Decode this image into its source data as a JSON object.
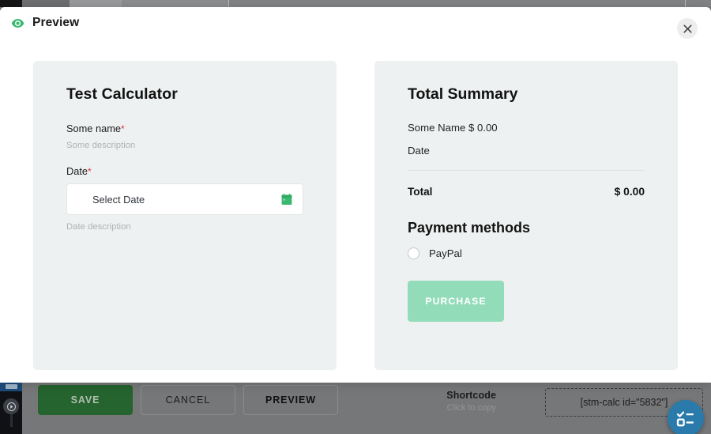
{
  "modal": {
    "title": "Preview",
    "eye_icon": "eye-icon",
    "close_icon": "close-icon"
  },
  "calculator": {
    "title": "Test Calculator",
    "fields": [
      {
        "label": "Some name",
        "required_mark": "*",
        "description": "Some description"
      },
      {
        "label": "Date",
        "required_mark": "*",
        "placeholder": "Select Date",
        "description": "Date description",
        "icon": "calendar-icon"
      }
    ]
  },
  "summary": {
    "title": "Total Summary",
    "lines": [
      "Some Name $ 0.00",
      "Date"
    ],
    "total_label": "Total",
    "total_value": "$ 0.00",
    "payment_title": "Payment methods",
    "payment_methods": [
      {
        "label": "PayPal",
        "selected": false
      }
    ],
    "purchase_label": "PURCHASE"
  },
  "actionbar": {
    "save_label": "SAVE",
    "cancel_label": "CANCEL",
    "preview_label": "PREVIEW",
    "shortcode_title": "Shortcode",
    "shortcode_sub": "Click to copy",
    "shortcode_value": "[stm-calc id=\"5832\"]",
    "fab_icon": "checklist-icon"
  },
  "colors": {
    "accent_green": "#25632f",
    "icon_green": "#3ab870",
    "purchase_green": "#93dcba",
    "fab_blue": "#2a7bab",
    "required_red": "#e0333a",
    "panel_bg": "#eef1f1",
    "overlay_gray": "#777879"
  }
}
